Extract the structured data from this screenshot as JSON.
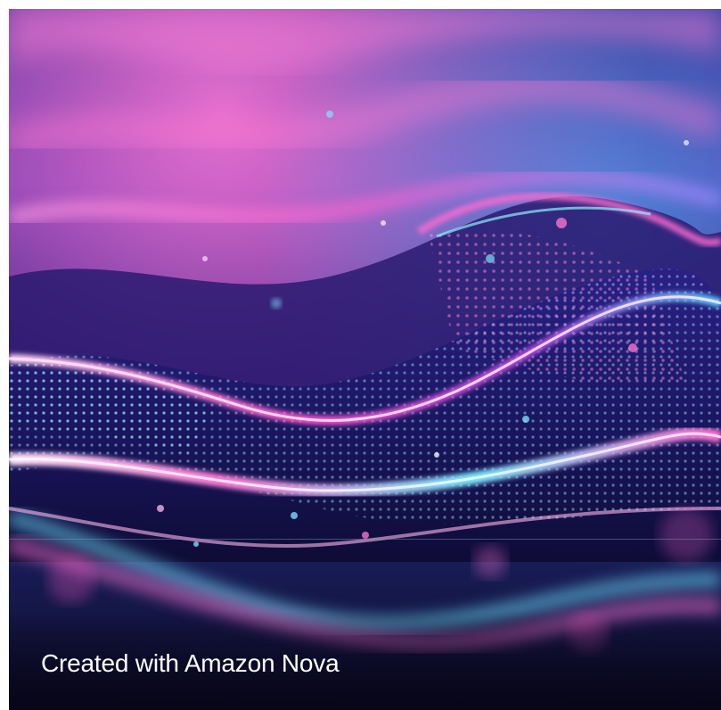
{
  "image": {
    "subject": "abstract-neon-wave",
    "colors": {
      "magenta": "#ff5fd0",
      "pink": "#ff8ad8",
      "cyan": "#5fe8ff",
      "deep_blue": "#1b1450",
      "purple": "#5a2fb0"
    }
  },
  "caption": {
    "text": "Created with Amazon Nova"
  }
}
